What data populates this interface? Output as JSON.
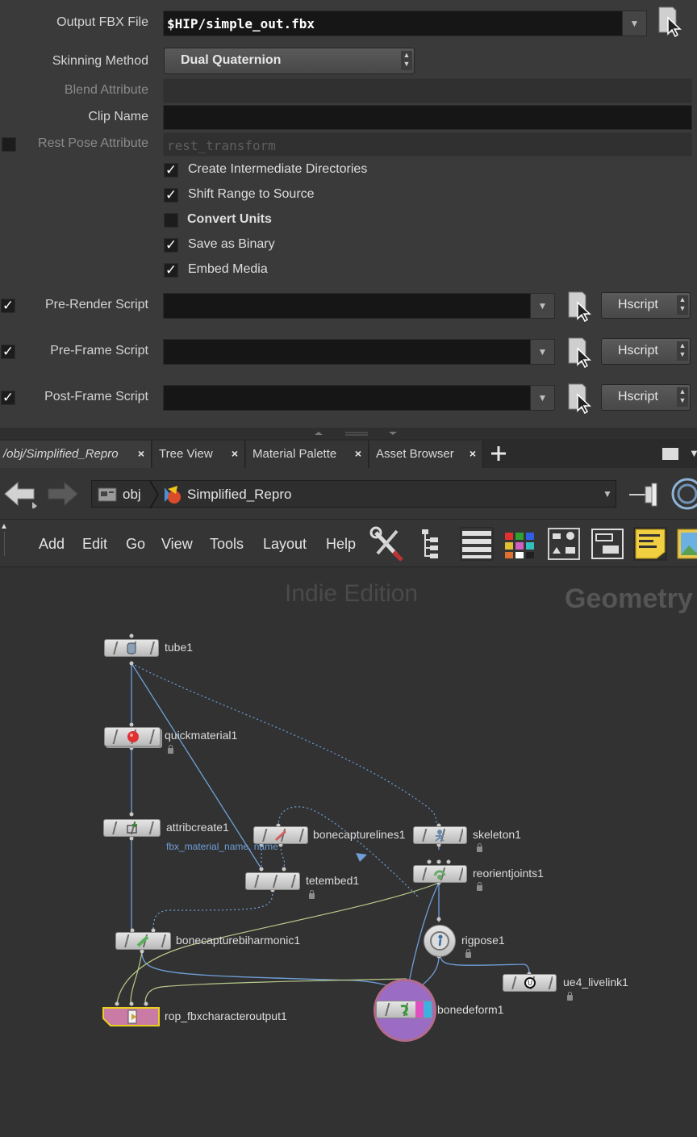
{
  "params": {
    "output_fbx": {
      "label": "Output FBX File",
      "value": "$HIP/simple_out.fbx"
    },
    "skinning": {
      "label": "Skinning Method",
      "value": "Dual Quaternion"
    },
    "blend_attr": {
      "label": "Blend Attribute",
      "value": ""
    },
    "clip_name": {
      "label": "Clip Name",
      "value": ""
    },
    "rest_pose": {
      "label": "Rest Pose Attribute",
      "value": "rest_transform",
      "checked": false
    },
    "checkboxes": [
      {
        "label": "Create Intermediate Directories",
        "checked": true
      },
      {
        "label": "Shift Range to Source",
        "checked": true
      },
      {
        "label": "Convert Units",
        "checked": false
      },
      {
        "label": "Save as Binary",
        "checked": true
      },
      {
        "label": "Embed Media",
        "checked": true
      }
    ],
    "scripts": [
      {
        "label": "Pre-Render Script",
        "checked": true,
        "value": "",
        "lang": "Hscript"
      },
      {
        "label": "Pre-Frame Script",
        "checked": true,
        "value": "",
        "lang": "Hscript"
      },
      {
        "label": "Post-Frame Script",
        "checked": true,
        "value": "",
        "lang": "Hscript"
      }
    ]
  },
  "tabs": [
    {
      "label": "/obj/Simplified_Repro",
      "active": true
    },
    {
      "label": "Tree View"
    },
    {
      "label": "Material Palette"
    },
    {
      "label": "Asset Browser"
    }
  ],
  "path": {
    "root": "obj",
    "node": "Simplified_Repro"
  },
  "menus": [
    "Add",
    "Edit",
    "Go",
    "View",
    "Tools",
    "Layout",
    "Help"
  ],
  "watermark": {
    "edition": "Indie Edition",
    "context": "Geometry"
  },
  "nodes": {
    "tube1": "tube1",
    "quickmaterial1": "quickmaterial1",
    "attribcreate1": "attribcreate1",
    "attribcreate1_note": "fbx_material_name, name",
    "bonecapturelines1": "bonecapturelines1",
    "skeleton1": "skeleton1",
    "tetembed1": "tetembed1",
    "reorientjoints1": "reorientjoints1",
    "bonecapturebiharmonic1": "bonecapturebiharmonic1",
    "rigpose1": "rigpose1",
    "ue4_livelink1": "ue4_livelink1",
    "rop_fbxcharacteroutput1": "rop_fbxcharacteroutput1",
    "bonedeform1": "bonedeform1"
  },
  "colors": {
    "wire": "#6f9fd8",
    "wire_yellow": "#b9c98a",
    "rop": "#c97aa5",
    "display_ring": "#9a6cc4"
  }
}
